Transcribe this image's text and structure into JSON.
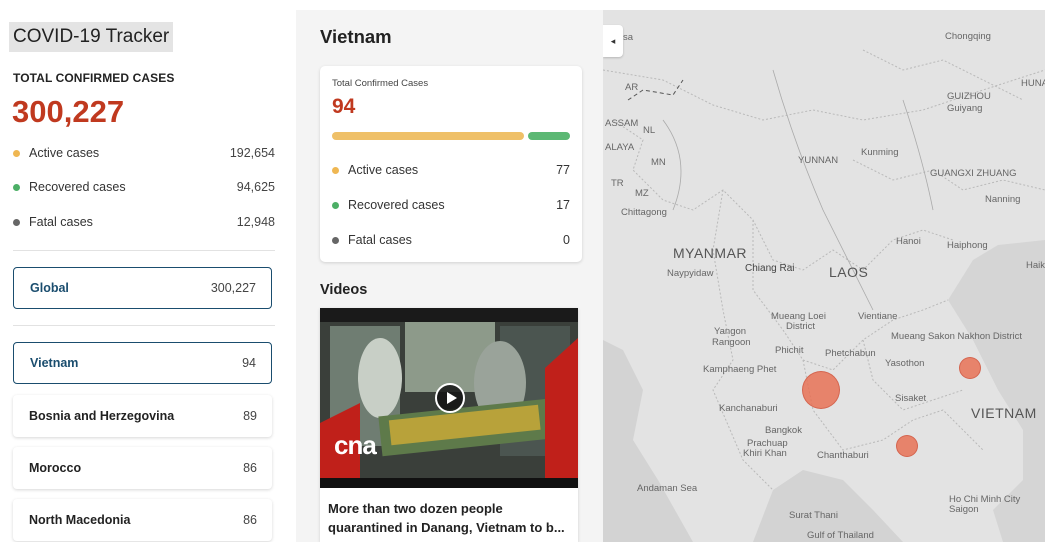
{
  "app": {
    "title": "COVID-19 Tracker"
  },
  "global_summary": {
    "label": "TOTAL CONFIRMED CASES",
    "total": "300,227",
    "stats": [
      {
        "label": "Active cases",
        "value": "192,654",
        "color": "#efb752"
      },
      {
        "label": "Recovered cases",
        "value": "94,625",
        "color": "#4caf66"
      },
      {
        "label": "Fatal cases",
        "value": "12,948",
        "color": "#666666"
      }
    ]
  },
  "region_list": {
    "global": {
      "name": "Global",
      "count": "300,227"
    },
    "countries": [
      {
        "name": "Vietnam",
        "count": "94"
      },
      {
        "name": "Bosnia and Herzegovina",
        "count": "89"
      },
      {
        "name": "Morocco",
        "count": "86"
      },
      {
        "name": "North Macedonia",
        "count": "86"
      }
    ]
  },
  "country_detail": {
    "name": "Vietnam",
    "card_label": "Total Confirmed Cases",
    "total": "94",
    "active_fraction": 0.82,
    "recovered_fraction": 0.18,
    "stats": [
      {
        "label": "Active cases",
        "value": "77",
        "color": "#efb752"
      },
      {
        "label": "Recovered cases",
        "value": "17",
        "color": "#4caf66"
      },
      {
        "label": "Fatal cases",
        "value": "0",
        "color": "#666666"
      }
    ]
  },
  "videos": {
    "heading": "Videos",
    "items": [
      {
        "caption": "More than two dozen people quarantined in Danang, Vietnam to b...",
        "source_logo": "cna"
      }
    ]
  },
  "map": {
    "collapse_glyph": "◂",
    "labels": {
      "chongqing": "Chongqing",
      "guizhou": "GUIZHOU",
      "guiyang": "Guiyang",
      "huna": "HUNA",
      "yunnan": "YUNNAN",
      "kunming": "Kunming",
      "guangxi": "GUANGXI ZHUANG",
      "nanning": "Nanning",
      "ar": "AR",
      "nl": "NL",
      "assam": "ASSAM",
      "mn": "MN",
      "alaya": "ALAYA",
      "tr": "TR",
      "mz": "MZ",
      "chittagong": "Chittagong",
      "myanmar": "MYANMAR",
      "naypyidaw": "Naypyidaw",
      "chiang_rai": "Chiang Rai",
      "laos": "LAOS",
      "hanoi": "Hanoi",
      "haiphong": "Haiphong",
      "hai": "Haik",
      "yangon": "Yangon",
      "rangoon": "Rangoon",
      "mueang_loei": "Mueang Loei",
      "district": "District",
      "vientiane": "Vientiane",
      "mueang_sakon": "Mueang Sakon Nakhon District",
      "phichit": "Phichit",
      "phetchabun": "Phetchabun",
      "kamphaeng": "Kamphaeng Phet",
      "yasothon": "Yasothon",
      "kanchanaburi": "Kanchanaburi",
      "sisaket": "Sisaket",
      "vietnam": "VIETNAM",
      "bangkok": "Bangkok",
      "prachuap": "Prachuap",
      "khiri_khan": "Khiri Khan",
      "chanthaburi": "Chanthaburi",
      "andaman": "Andaman Sea",
      "surat_thani": "Surat Thani",
      "gulf_thailand": "Gulf of Thailand",
      "hcmc": "Ho Chi Minh City",
      "saigon": "Saigon",
      "sa": "sa"
    }
  }
}
